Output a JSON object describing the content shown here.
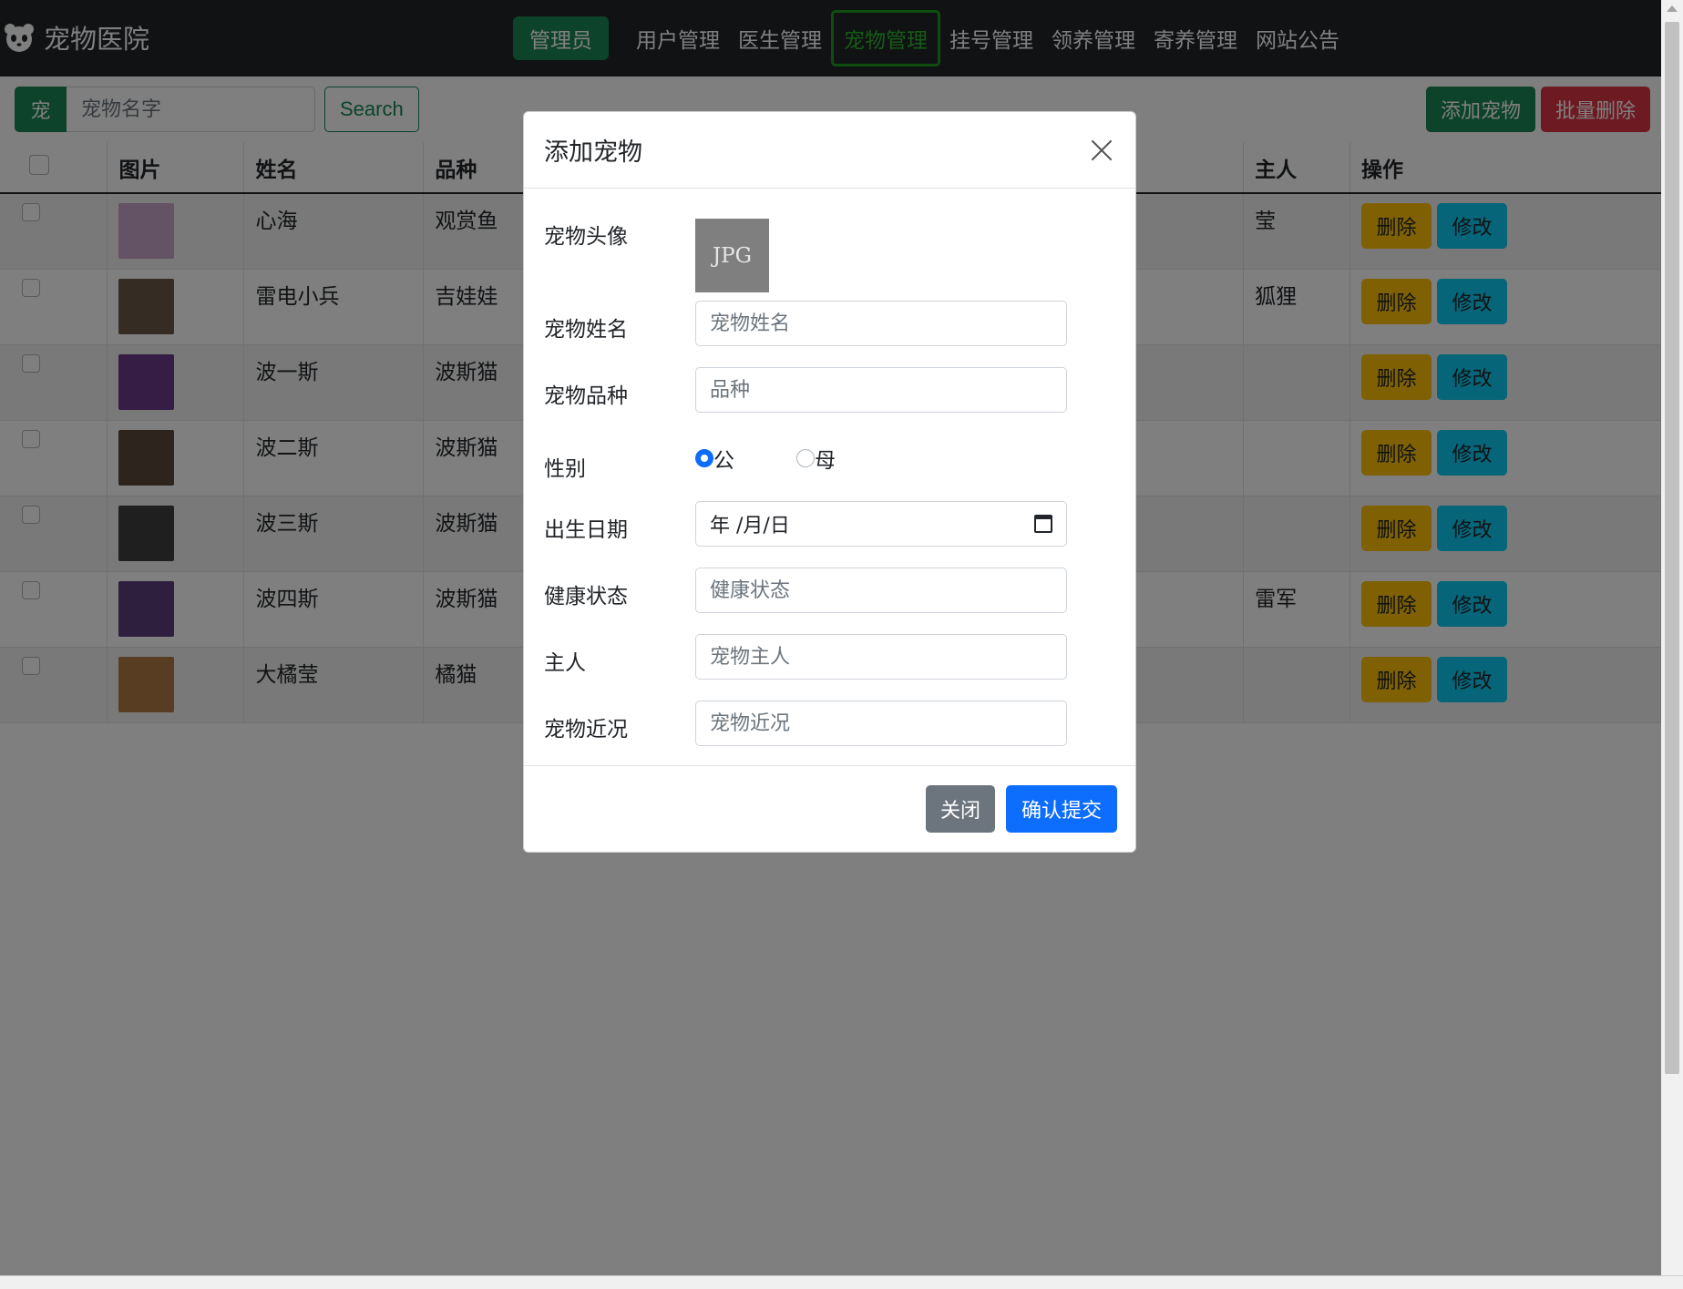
{
  "brand": {
    "title": "宠物医院",
    "icon": "panda-icon"
  },
  "nav": {
    "admin": "管理员",
    "links": [
      "用户管理",
      "医生管理",
      "宠物管理",
      "挂号管理",
      "领养管理",
      "寄养管理",
      "网站公告"
    ],
    "active_index": 2
  },
  "search": {
    "addon": "宠",
    "placeholder": "宠物名字",
    "value": "",
    "button": "Search"
  },
  "actions": {
    "add": "添加宠物",
    "batch_delete": "批量删除"
  },
  "table": {
    "headers": {
      "image": "图片",
      "name": "姓名",
      "breed": "品种",
      "owner": "主人",
      "ops": "操作"
    },
    "rows": [
      {
        "name": "心海",
        "breed": "观赏鱼",
        "owner": "莹",
        "thumb_color": "#c7a6c9",
        "del": "删除",
        "edit": "修改"
      },
      {
        "name": "雷电小兵",
        "breed": "吉娃娃",
        "owner": "狐狸",
        "thumb_color": "#6a5a48",
        "del": "删除",
        "edit": "修改"
      },
      {
        "name": "波一斯",
        "breed": "波斯猫",
        "owner": "",
        "thumb_color": "#6b3a8a",
        "del": "删除",
        "edit": "修改"
      },
      {
        "name": "波二斯",
        "breed": "波斯猫",
        "owner": "",
        "thumb_color": "#5a4a3a",
        "del": "删除",
        "edit": "修改"
      },
      {
        "name": "波三斯",
        "breed": "波斯猫",
        "owner": "",
        "thumb_color": "#3f3f3f",
        "del": "删除",
        "edit": "修改"
      },
      {
        "name": "波四斯",
        "breed": "波斯猫",
        "owner": "雷军",
        "thumb_color": "#5a3f7a",
        "del": "删除",
        "edit": "修改"
      },
      {
        "name": "大橘莹",
        "breed": "橘猫",
        "owner": "",
        "thumb_color": "#b07a44",
        "del": "删除",
        "edit": "修改"
      }
    ]
  },
  "modal": {
    "title": "添加宠物",
    "fields": {
      "avatar_label": "宠物头像",
      "avatar_text": "JPG",
      "name_label": "宠物姓名",
      "name_placeholder": "宠物姓名",
      "breed_label": "宠物品种",
      "breed_placeholder": "品种",
      "gender_label": "性别",
      "gender_male": "公",
      "gender_female": "母",
      "gender_selected": "公",
      "birth_label": "出生日期",
      "birth_value": "年 /月/日",
      "health_label": "健康状态",
      "health_placeholder": "健康状态",
      "owner_label": "主人",
      "owner_placeholder": "宠物主人",
      "status_label": "宠物近况",
      "status_placeholder": "宠物近况"
    },
    "close_button": "关闭",
    "submit_button": "确认提交"
  },
  "colors": {
    "success": "#198754",
    "danger": "#dc3545",
    "warning": "#ffc107",
    "info": "#0dcaf0",
    "primary": "#0d6efd",
    "secondary": "#6c757d"
  }
}
